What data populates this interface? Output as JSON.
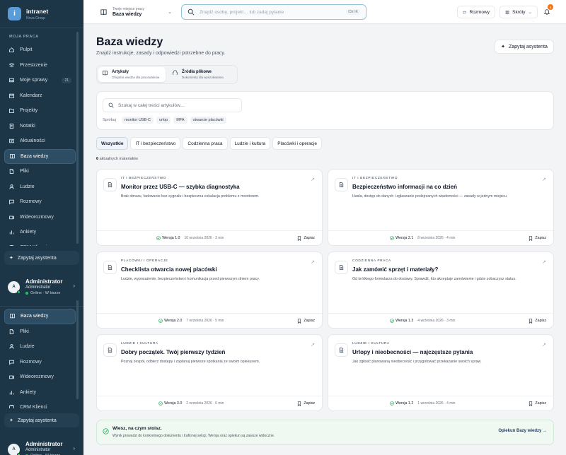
{
  "sidebar": {
    "brand": {
      "name": "intranet",
      "sub": "Nova Group",
      "logo": "i"
    },
    "section_label": "MOJA PRACA",
    "nav_top": [
      {
        "label": "Pulpit",
        "icon": "home-icon"
      },
      {
        "label": "Przestrzenie",
        "icon": "spaces-icon"
      },
      {
        "label": "Moje sprawy",
        "icon": "inbox-icon",
        "badge": "21"
      },
      {
        "label": "Kalendarz",
        "icon": "calendar-icon"
      },
      {
        "label": "Projekty",
        "icon": "folder-icon"
      },
      {
        "label": "Notatki",
        "icon": "note-icon"
      },
      {
        "label": "Aktualności",
        "icon": "news-icon"
      },
      {
        "label": "Baza wiedzy",
        "icon": "book-icon",
        "active": true
      },
      {
        "label": "Pliki",
        "icon": "file-icon"
      },
      {
        "label": "Ludzie",
        "icon": "people-icon"
      },
      {
        "label": "Rozmowy",
        "icon": "chat-icon"
      },
      {
        "label": "Wideorozmowy",
        "icon": "video-icon"
      },
      {
        "label": "Ankiety",
        "icon": "chart-icon"
      },
      {
        "label": "CRM Klienci",
        "icon": "crm-icon"
      }
    ],
    "nav_bottom": [
      {
        "label": "Baza wiedzy",
        "icon": "book-icon",
        "active": true
      },
      {
        "label": "Pliki",
        "icon": "file-icon"
      },
      {
        "label": "Ludzie",
        "icon": "people-icon"
      },
      {
        "label": "Rozmowy",
        "icon": "chat-icon"
      },
      {
        "label": "Wideorozmowy",
        "icon": "video-icon"
      },
      {
        "label": "Ankiety",
        "icon": "chart-icon"
      },
      {
        "label": "CRM Klienci",
        "icon": "crm-icon"
      }
    ],
    "assistant_label": "Zapytaj asystenta",
    "user": {
      "initial": "A",
      "name": "Administrator",
      "role": "Administrator",
      "status": "Online · W biurze"
    }
  },
  "topbar": {
    "workspace_label": "Twoje miejsce pracy",
    "workspace_name": "Baza wiedzy",
    "search_placeholder": "Znajdź osobę, projekt… lub zadaj pytanie",
    "search_shortcut": "Ctrl K",
    "conversations": "Rozmowy",
    "shortcuts": "Skróty",
    "notifications_count": "4"
  },
  "page": {
    "title": "Baza wiedzy",
    "subtitle": "Znajdź instrukcje, zasady i odpowiedzi potrzebne do pracy.",
    "ask_button": "Zapytaj asystenta",
    "source_tabs": [
      {
        "title": "Artykuły",
        "desc": "Oficjalna wiedza dla pracowników",
        "active": true
      },
      {
        "title": "Źródła plikowe",
        "desc": "Dokumenty dla wyszukiwania",
        "active": false
      }
    ],
    "search_placeholder": "Szukaj w całej treści artykułów…",
    "try_label": "Spróbuj",
    "suggestions": [
      "monitor USB-C",
      "urlop",
      "MFA",
      "otwarcie placówki"
    ],
    "filters": [
      {
        "label": "Wszystkie",
        "active": true
      },
      {
        "label": "IT i bezpieczeństwo"
      },
      {
        "label": "Codzienna praca"
      },
      {
        "label": "Ludzie i kultura"
      },
      {
        "label": "Placówki i operacje"
      }
    ],
    "count_number": "6",
    "count_text": "aktualnych materiałów",
    "save_label": "Zapisz",
    "articles": [
      {
        "category": "IT I BEZPIECZEŃSTWO",
        "title": "Monitor przez USB-C — szybka diagnostyka",
        "desc": "Brak obrazu, fadowanie bez sygnału i bezpieczna eskalacja problemu z monitorem.",
        "version": "Wersja 1.0",
        "meta": "10 września 2026 · 3 min"
      },
      {
        "category": "IT I BEZPIECZEŃSTWO",
        "title": "Bezpieczeństwo informacji na co dzień",
        "desc": "Hasła, dostęp do danych i zgłaszanie podejrzanych wiadomości — zasady w jednym miejscu.",
        "version": "Wersja 2.1",
        "meta": "8 września 2026 · 4 min"
      },
      {
        "category": "PLACÓWKI I OPERACJE",
        "title": "Checklista otwarcia nowej placówki",
        "desc": "Ludzie, wyposażenie, bezpieczeństwo i komunikacja przed pierwszym dniem pracy.",
        "version": "Wersja 2.0",
        "meta": "7 września 2026 · 5 min"
      },
      {
        "category": "CODZIENNA PRACA",
        "title": "Jak zamówić sprzęt i materiały?",
        "desc": "Od krótkiego formularza do dostawy. Sprawdź, kto akceptuje zamówienie i gdzie zobaczysz status.",
        "version": "Wersja 1.3",
        "meta": "4 września 2026 · 3 min"
      },
      {
        "category": "LUDZIE I KULTURA",
        "title": "Dobry początek. Twój pierwszy tydzień",
        "desc": "Poznaj zespół, odbierz dostępy i zaplanuj pierwsze spotkania ze swoim opiekunem.",
        "version": "Wersja 3.0",
        "meta": "2 września 2026 · 6 min"
      },
      {
        "category": "LUDZIE I KULTURA",
        "title": "Urlopy i nieobecności — najczęstsze pytania",
        "desc": "Jak zgłosić planowaną nieobecność i przygotować przekazanie swoich spraw.",
        "version": "Wersja 1.2",
        "meta": "1 września 2026 · 4 min"
      }
    ],
    "tip": {
      "title": "Wiesz, na czym stoisz.",
      "text": "Wynik prowadzi do konkretnego dokumentu i trafionej sekcji. Wersja oraz opiekun są zawsze widoczne.",
      "link": "Opiekun Bazy wiedzy →"
    }
  }
}
